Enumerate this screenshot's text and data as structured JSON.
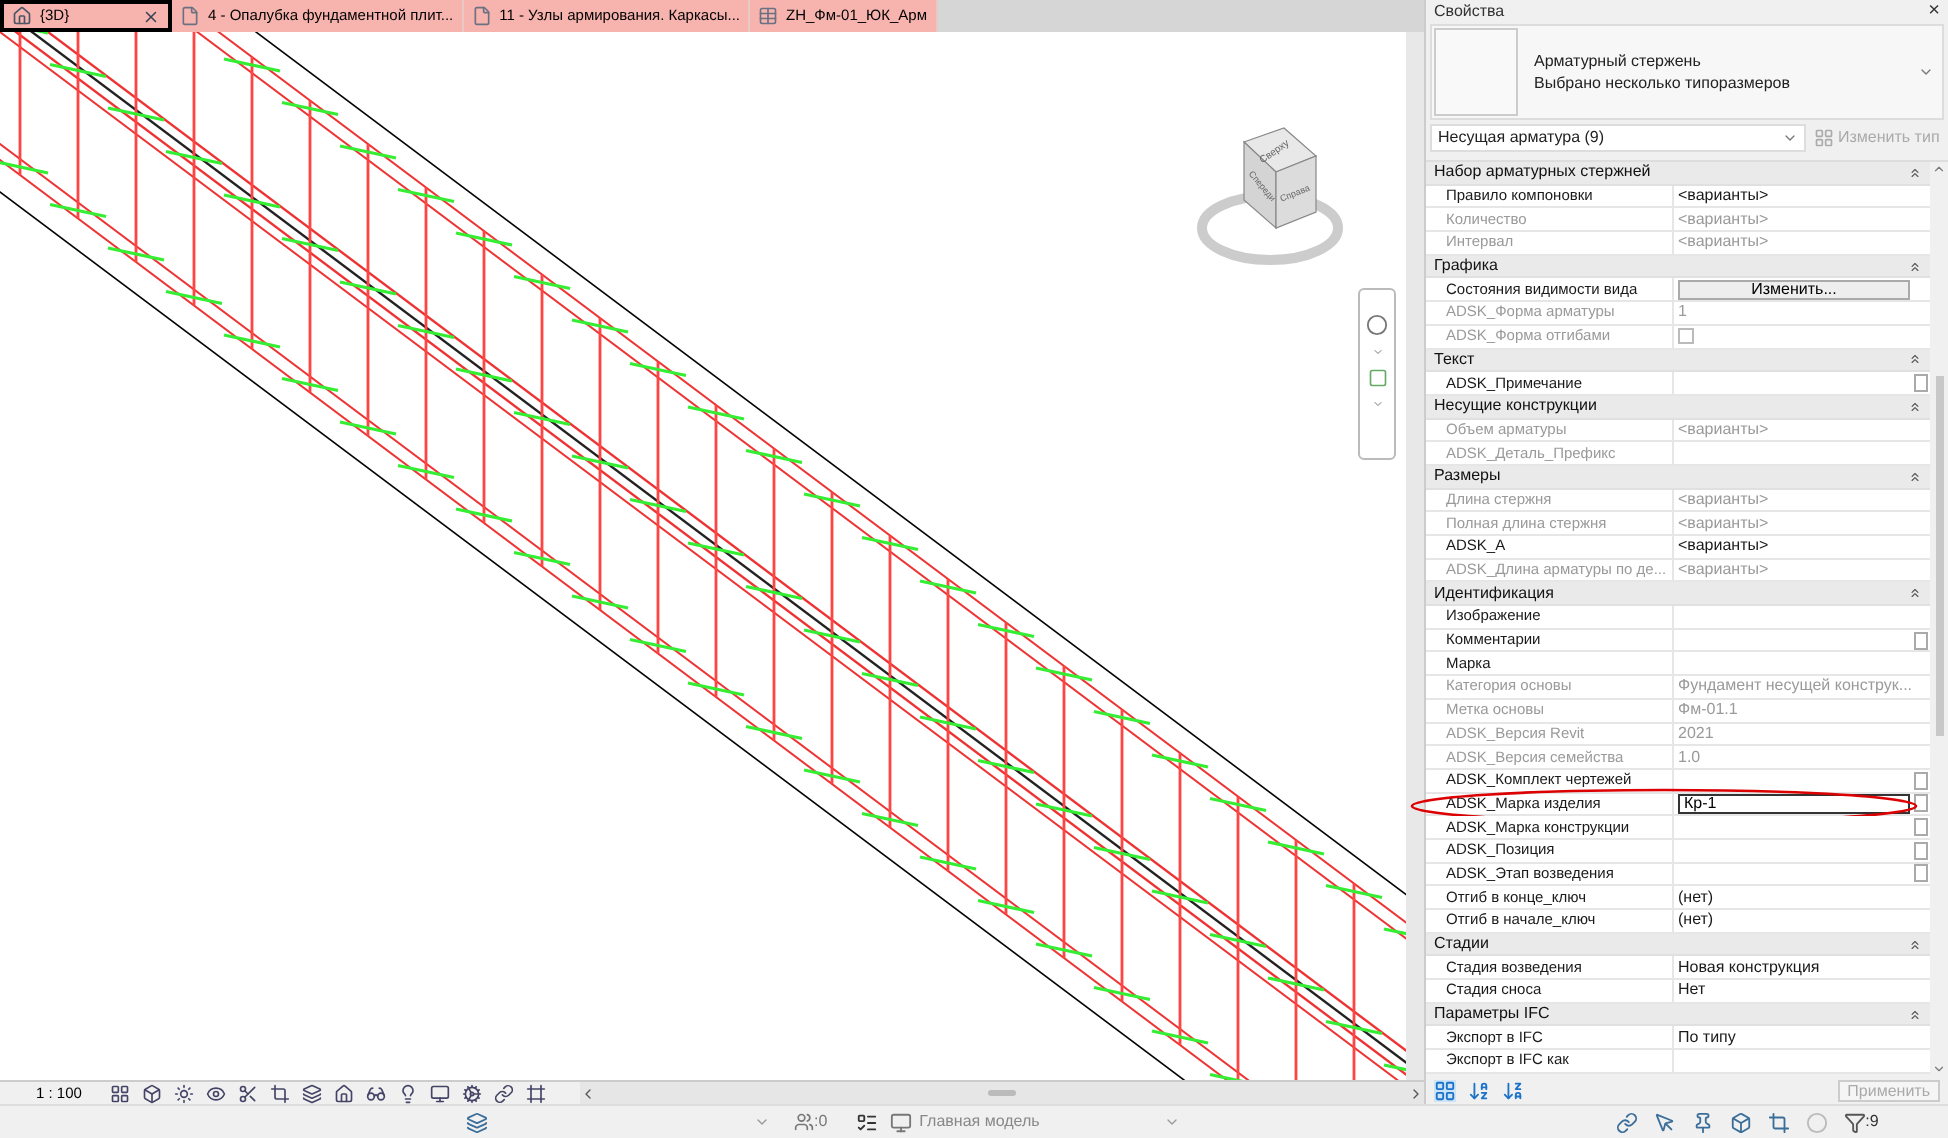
{
  "tabs": [
    {
      "label": "{3D}",
      "kind": "view3d",
      "selected": true,
      "closable": true
    },
    {
      "label": "4 - Опалубка фундаментной плит...",
      "kind": "sheet",
      "selected": false,
      "closable": false
    },
    {
      "label": "11 - Узлы армирования. Каркасы...",
      "kind": "sheet",
      "selected": false,
      "closable": false
    },
    {
      "label": "ZH_Фм-01_ЮК_Арм",
      "kind": "schedule",
      "selected": false,
      "closable": false
    }
  ],
  "view_cube": {
    "faces": [
      "Сверху",
      "Спереди",
      "Справа"
    ]
  },
  "view_bar": {
    "scale": "1 : 100"
  },
  "properties": {
    "title": "Свойства",
    "close": "×",
    "type_lines": [
      "Арматурный стержень",
      "Выбрано несколько типоразмеров"
    ],
    "filter": "Несущая арматура (9)",
    "edit_type": "Изменить тип",
    "apply": "Применить",
    "groups": [
      {
        "title": "Набор арматурных стержней",
        "rows": [
          {
            "name": "Правило компоновки",
            "value": "<варианты>",
            "kind": "text",
            "disabled": false,
            "side_box": false,
            "circled": false
          },
          {
            "name": "Количество",
            "value": "<варианты>",
            "kind": "text",
            "disabled": true,
            "side_box": false,
            "circled": false
          },
          {
            "name": "Интервал",
            "value": "<варианты>",
            "kind": "text",
            "disabled": true,
            "side_box": false,
            "circled": false
          }
        ]
      },
      {
        "title": "Графика",
        "rows": [
          {
            "name": "Состояния видимости вида",
            "value": "Изменить...",
            "kind": "button",
            "disabled": false,
            "side_box": false,
            "circled": false
          },
          {
            "name": "ADSK_Форма арматуры",
            "value": "1",
            "kind": "text",
            "disabled": true,
            "side_box": false,
            "circled": false
          },
          {
            "name": "ADSK_Форма отгибами",
            "kind": "checkbox",
            "checked": false,
            "disabled": true,
            "side_box": false,
            "circled": false
          }
        ]
      },
      {
        "title": "Текст",
        "rows": [
          {
            "name": "ADSK_Примечание",
            "kind": "text",
            "disabled": false,
            "side_box": true,
            "circled": false
          }
        ]
      },
      {
        "title": "Несущие конструкции",
        "rows": [
          {
            "name": "Объем арматуры",
            "value": "<варианты>",
            "kind": "text",
            "disabled": true,
            "side_box": false,
            "circled": false
          },
          {
            "name": "ADSK_Деталь_Префикс",
            "kind": "text",
            "disabled": true,
            "side_box": false,
            "circled": false
          }
        ]
      },
      {
        "title": "Размеры",
        "rows": [
          {
            "name": "Длина стержня",
            "value": "<варианты>",
            "kind": "text",
            "disabled": true,
            "side_box": false,
            "circled": false
          },
          {
            "name": "Полная длина стержня",
            "value": "<варианты>",
            "kind": "text",
            "disabled": true,
            "side_box": false,
            "circled": false
          },
          {
            "name": "ADSK_A",
            "value": "<варианты>",
            "kind": "text",
            "disabled": false,
            "side_box": false,
            "circled": false
          },
          {
            "name": "ADSK_Длина арматуры по де...",
            "value": "<варианты>",
            "kind": "text",
            "disabled": true,
            "side_box": false,
            "circled": false
          }
        ]
      },
      {
        "title": "Идентификация",
        "rows": [
          {
            "name": "Изображение",
            "kind": "text",
            "disabled": false,
            "side_box": false,
            "circled": false
          },
          {
            "name": "Комментарии",
            "kind": "text",
            "disabled": false,
            "side_box": true,
            "circled": false
          },
          {
            "name": "Марка",
            "kind": "text",
            "disabled": false,
            "side_box": false,
            "circled": false
          },
          {
            "name": "Категория основы",
            "value": "Фундамент несущей конструк...",
            "kind": "text",
            "disabled": true,
            "side_box": false,
            "circled": false
          },
          {
            "name": "Метка основы",
            "value": "Фм-01.1",
            "kind": "text",
            "disabled": true,
            "side_box": false,
            "circled": false
          },
          {
            "name": "ADSK_Версия Revit",
            "value": "2021",
            "kind": "text",
            "disabled": true,
            "side_box": false,
            "circled": false
          },
          {
            "name": "ADSK_Версия семейства",
            "value": "1.0",
            "kind": "text",
            "disabled": true,
            "side_box": false,
            "circled": false
          },
          {
            "name": "ADSK_Комплект чертежей",
            "kind": "text",
            "disabled": false,
            "side_box": true,
            "circled": false
          },
          {
            "name": "ADSK_Марка изделия",
            "value": "Кр-1",
            "kind": "input",
            "disabled": false,
            "side_box": true,
            "circled": true
          },
          {
            "name": "ADSK_Марка конструкции",
            "kind": "text",
            "disabled": false,
            "side_box": true,
            "circled": false
          },
          {
            "name": "ADSK_Позиция",
            "kind": "text",
            "disabled": false,
            "side_box": true,
            "circled": false
          },
          {
            "name": "ADSK_Этап возведения",
            "kind": "text",
            "disabled": false,
            "side_box": true,
            "circled": false
          },
          {
            "name": "Отгиб в конце_ключ",
            "value": "(нет)",
            "kind": "text",
            "disabled": false,
            "side_box": false,
            "circled": false
          },
          {
            "name": "Отгиб в начале_ключ",
            "value": "(нет)",
            "kind": "text",
            "disabled": false,
            "side_box": false,
            "circled": false
          }
        ]
      },
      {
        "title": "Стадии",
        "rows": [
          {
            "name": "Стадия возведения",
            "value": "Новая конструкция",
            "kind": "text",
            "disabled": false,
            "side_box": false,
            "circled": false
          },
          {
            "name": "Стадия сноса",
            "value": "Нет",
            "kind": "text",
            "disabled": false,
            "side_box": false,
            "circled": false
          }
        ]
      },
      {
        "title": "Параметры IFC",
        "rows": [
          {
            "name": "Экспорт в IFC",
            "value": "По типу",
            "kind": "text",
            "disabled": false,
            "side_box": false,
            "circled": false
          },
          {
            "name": "Экспорт в IFC как",
            "kind": "text",
            "disabled": false,
            "side_box": false,
            "circled": false
          }
        ]
      }
    ]
  },
  "status_bar": {
    "worksharing": ":0",
    "model": "Главная модель",
    "selection": ":9"
  }
}
